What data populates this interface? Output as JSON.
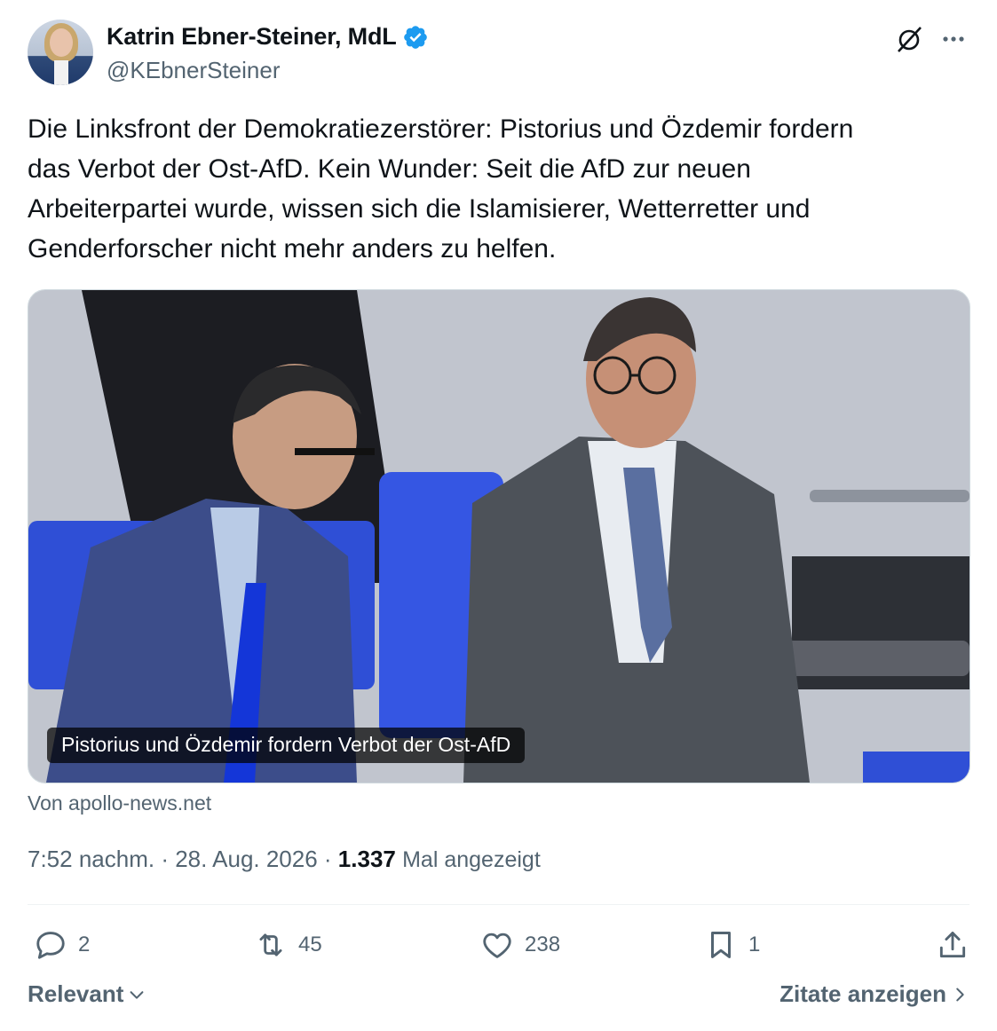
{
  "author": {
    "name": "Katrin Ebner-Steiner, MdL",
    "handle": "@KEbnerSteiner",
    "verified": true,
    "verified_color": "#1d9bf0"
  },
  "tweet": {
    "text": "Die Linksfront der Demokratiezerstörer: Pistorius und Özdemir fordern\ndas Verbot der Ost-AfD. Kein Wunder: Seit die AfD zur neuen\nArbeiterpartei wurde, wissen sich die Islamisierer, Wetterretter und\nGenderforscher nicht mehr anders zu helfen."
  },
  "link_card": {
    "caption": "Pistorius und Özdemir fordern Verbot der Ost-AfD",
    "source": "Von apollo-news.net"
  },
  "meta": {
    "time": "7:52 nachm.",
    "sep1": " · ",
    "date": "28. Aug. 2026",
    "sep2": " · ",
    "views_count": "1.337",
    "views_label": "Mal angezeigt"
  },
  "actions": {
    "replies": "2",
    "reposts": "45",
    "likes": "238",
    "bookmarks": "1"
  },
  "footer": {
    "sort_label": "Relevant",
    "quotes_label": "Zitate anzeigen"
  },
  "icons": {
    "header_right": [
      "grok-icon",
      "more-icon"
    ],
    "actions": [
      "reply-icon",
      "repost-icon",
      "like-icon",
      "bookmark-icon",
      "share-icon"
    ]
  },
  "colors": {
    "text": "#0f1419",
    "secondary": "#536471",
    "divider": "#eff3f4"
  }
}
